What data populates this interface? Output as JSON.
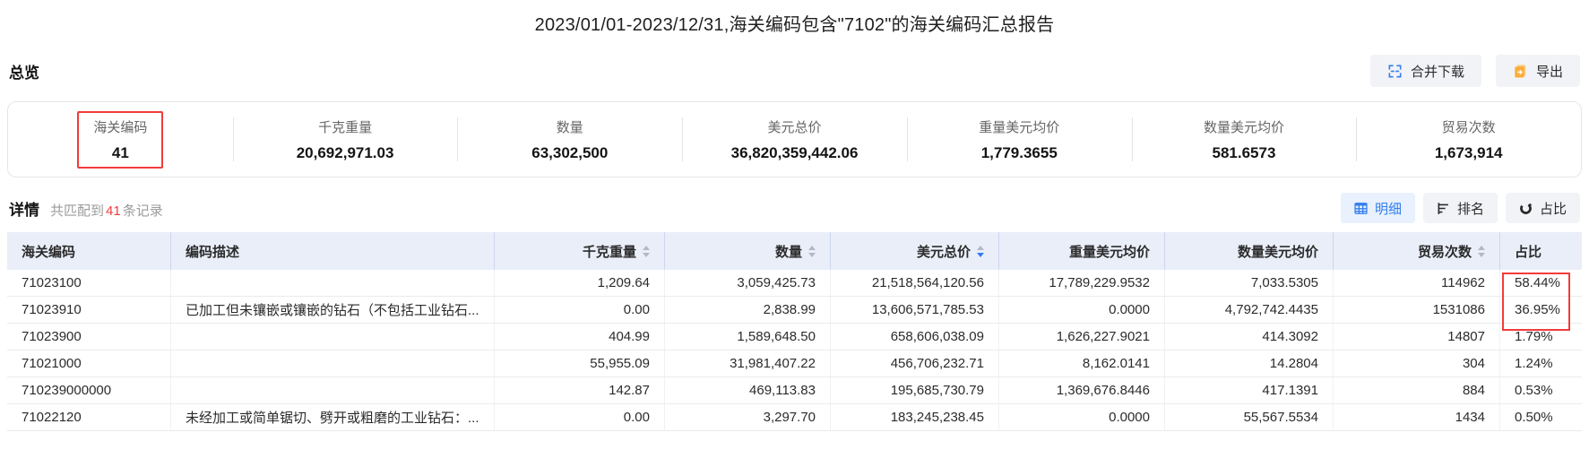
{
  "page": {
    "title": "2023/01/01-2023/12/31,海关编码包含\"7102\"的海关编码汇总报告"
  },
  "overview": {
    "section_title": "总览",
    "merge_download_label": "合并下载",
    "export_label": "导出",
    "stats": [
      {
        "label": "海关编码",
        "value": "41",
        "highlighted": true
      },
      {
        "label": "千克重量",
        "value": "20,692,971.03",
        "highlighted": false
      },
      {
        "label": "数量",
        "value": "63,302,500",
        "highlighted": false
      },
      {
        "label": "美元总价",
        "value": "36,820,359,442.06",
        "highlighted": false
      },
      {
        "label": "重量美元均价",
        "value": "1,779.3655",
        "highlighted": false
      },
      {
        "label": "数量美元均价",
        "value": "581.6573",
        "highlighted": false
      },
      {
        "label": "贸易次数",
        "value": "1,673,914",
        "highlighted": false
      }
    ]
  },
  "details": {
    "section_title": "详情",
    "match_prefix": "共匹配到",
    "match_count": "41",
    "match_suffix": "条记录",
    "tabs": [
      {
        "label": "明细",
        "icon": "table-icon",
        "active": true
      },
      {
        "label": "排名",
        "icon": "ranking-icon",
        "active": false
      },
      {
        "label": "占比",
        "icon": "pie-icon",
        "active": false
      }
    ]
  },
  "table": {
    "columns": [
      {
        "label": "海关编码",
        "align": "left",
        "sortable": false,
        "sort_active": ""
      },
      {
        "label": "编码描述",
        "align": "left",
        "sortable": false,
        "sort_active": ""
      },
      {
        "label": "千克重量",
        "align": "right",
        "sortable": true,
        "sort_active": ""
      },
      {
        "label": "数量",
        "align": "right",
        "sortable": true,
        "sort_active": ""
      },
      {
        "label": "美元总价",
        "align": "right",
        "sortable": true,
        "sort_active": "desc"
      },
      {
        "label": "重量美元均价",
        "align": "right",
        "sortable": false,
        "sort_active": ""
      },
      {
        "label": "数量美元均价",
        "align": "right",
        "sortable": false,
        "sort_active": ""
      },
      {
        "label": "贸易次数",
        "align": "right",
        "sortable": true,
        "sort_active": ""
      },
      {
        "label": "占比",
        "align": "left",
        "sortable": false,
        "sort_active": ""
      }
    ],
    "rows": [
      [
        "71023100",
        "",
        "1,209.64",
        "3,059,425.73",
        "21,518,564,120.56",
        "17,789,229.9532",
        "7,033.5305",
        "114962",
        "58.44%"
      ],
      [
        "71023910",
        "已加工但未镶嵌或镶嵌的钻石（不包括工业钻石...",
        "0.00",
        "2,838.99",
        "13,606,571,785.53",
        "0.0000",
        "4,792,742.4435",
        "1531086",
        "36.95%"
      ],
      [
        "71023900",
        "",
        "404.99",
        "1,589,648.50",
        "658,606,038.09",
        "1,626,227.9021",
        "414.3092",
        "14807",
        "1.79%"
      ],
      [
        "71021000",
        "",
        "55,955.09",
        "31,981,407.22",
        "456,706,232.71",
        "8,162.0141",
        "14.2804",
        "304",
        "1.24%"
      ],
      [
        "710239000000",
        "",
        "142.87",
        "469,113.83",
        "195,685,730.79",
        "1,369,676.8446",
        "417.1391",
        "884",
        "0.53%"
      ],
      [
        "71022120",
        "未经加工或简单锯切、劈开或粗磨的工业钻石：...",
        "0.00",
        "3,297.70",
        "183,245,238.45",
        "0.0000",
        "55,567.5534",
        "1434",
        "0.50%"
      ]
    ]
  },
  "annotations": {
    "customs_code_highlight": "red-box-around-customs-code-stat",
    "ratio_highlight": "red-box-around-top-two-ratio-values"
  },
  "colors": {
    "accent_blue": "#337df0",
    "highlight_red": "#f23b3b",
    "export_orange": "#fbac38",
    "header_bg": "#e9eef9",
    "button_bg": "#f2f3f6",
    "active_tab_bg": "#e8f1fd",
    "muted_text": "#9b9b9b"
  }
}
